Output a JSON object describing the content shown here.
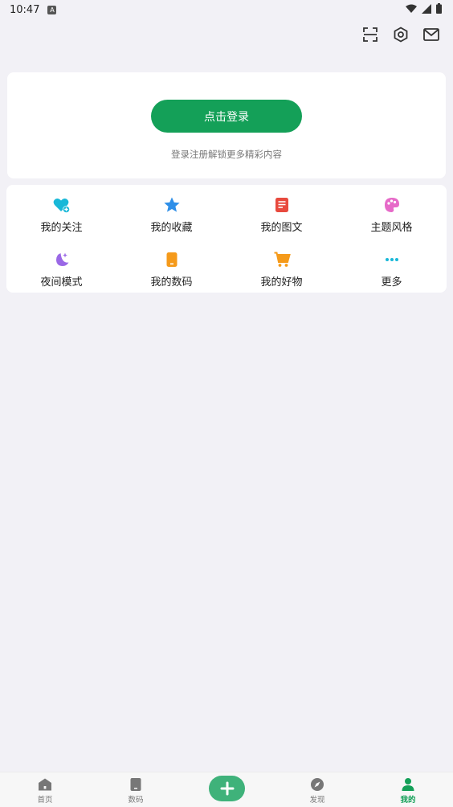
{
  "status_bar": {
    "time": "10:47",
    "app_badge": "A"
  },
  "login": {
    "button_label": "点击登录",
    "hint": "登录注册解锁更多精彩内容"
  },
  "menu": {
    "items": [
      {
        "label": "我的关注",
        "icon": "heart-plus-icon",
        "color": "#18b8d8"
      },
      {
        "label": "我的收藏",
        "icon": "star-icon",
        "color": "#2f8fe8"
      },
      {
        "label": "我的图文",
        "icon": "document-icon",
        "color": "#e84a3e"
      },
      {
        "label": "主题风格",
        "icon": "palette-icon",
        "color": "#e66ac8"
      },
      {
        "label": "夜间模式",
        "icon": "moon-icon",
        "color": "#9a68e6"
      },
      {
        "label": "我的数码",
        "icon": "phone-icon",
        "color": "#f59a1a"
      },
      {
        "label": "我的好物",
        "icon": "cart-icon",
        "color": "#f59a1a"
      },
      {
        "label": "更多",
        "icon": "more-icon",
        "color": "#18b8d8"
      }
    ]
  },
  "bottom_nav": {
    "items": [
      {
        "label": "首页",
        "icon": "home-icon"
      },
      {
        "label": "数码",
        "icon": "phone-icon"
      },
      {
        "label": "发现",
        "icon": "compass-icon"
      },
      {
        "label": "我的",
        "icon": "user-icon",
        "active": true
      }
    ]
  },
  "colors": {
    "accent": "#14a058",
    "background": "#f2f1f6"
  }
}
